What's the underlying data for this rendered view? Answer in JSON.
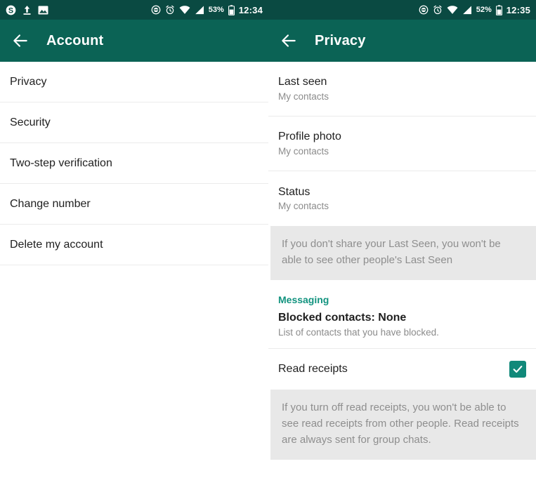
{
  "left": {
    "statusbar": {
      "icons_left": [
        "skype-icon",
        "upload-icon",
        "image-icon"
      ],
      "icons_right": [
        "do-not-disturb-icon",
        "alarm-icon",
        "wifi-icon",
        "signal-icon"
      ],
      "battery_pct": "53%",
      "time": "12:34"
    },
    "toolbar": {
      "back": "back-arrow",
      "title": "Account"
    },
    "items": [
      {
        "label": "Privacy"
      },
      {
        "label": "Security"
      },
      {
        "label": "Two-step verification"
      },
      {
        "label": "Change number"
      },
      {
        "label": "Delete my account"
      }
    ]
  },
  "right": {
    "statusbar": {
      "icons_right": [
        "do-not-disturb-icon",
        "alarm-icon",
        "wifi-icon",
        "signal-icon"
      ],
      "battery_pct": "52%",
      "time": "12:35"
    },
    "toolbar": {
      "back": "back-arrow",
      "title": "Privacy"
    },
    "privacy_rows": [
      {
        "title": "Last seen",
        "value": "My contacts"
      },
      {
        "title": "Profile photo",
        "value": "My contacts"
      },
      {
        "title": "Status",
        "value": "My contacts"
      }
    ],
    "info_last_seen": "If you don't share your Last Seen, you won't be able to see other people's Last Seen",
    "messaging_label": "Messaging",
    "blocked": {
      "title": "Blocked contacts: None",
      "subtitle": "List of contacts that you have blocked."
    },
    "read_receipts": {
      "label": "Read receipts",
      "checked": true
    },
    "info_read_receipts": "If you turn off read receipts, you won't be able to see read receipts from other people. Read receipts are always sent for group chats."
  },
  "colors": {
    "statusbar": "#0a4a42",
    "toolbar": "#0b6355",
    "accent": "#12937f",
    "checkbox": "#11897a",
    "info_bg": "#e8e8e8"
  }
}
